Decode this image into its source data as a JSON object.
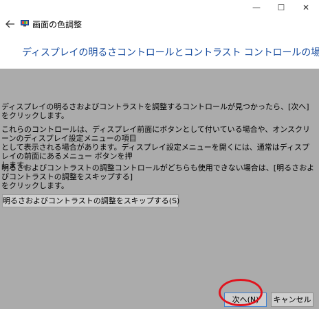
{
  "window": {
    "app_title": "画面の色調整",
    "controls": {
      "minimize": "—",
      "maximize": "☐",
      "close": "✕"
    }
  },
  "header": {
    "back_icon": "back-arrow-icon",
    "page_title": "ディスプレイの明るさコントロールとコントラスト コントロールの場所"
  },
  "main": {
    "paragraph1": "ディスプレイの明るさおよびコントラストを調整するコントロールが見つかったら、[次へ] をクリックします。",
    "paragraph2": "これらのコントロールは、ディスプレイ前面にボタンとして付いている場合や、オンスクリーンのディスプレイ設定メニューの項目\nとして表示される場合があります。ディスプレイ設定メニューを開くには、通常はディスプレイの前面にあるメニュー ボタンを押\nします。",
    "paragraph3": "明るさおよびコントラストの調整コントロールがどちらも使用できない場合は、[明るさおよびコントラストの調整をスキップする]\nをクリックします。",
    "skip_button": "明るさおよびコントラストの調整をスキップする(S)"
  },
  "footer": {
    "next_button": "次へ(N)",
    "cancel_button": "キャンセル"
  },
  "colors": {
    "accent": "#1a4ea0",
    "background": "#ababab",
    "annotation": "#e0141e"
  }
}
